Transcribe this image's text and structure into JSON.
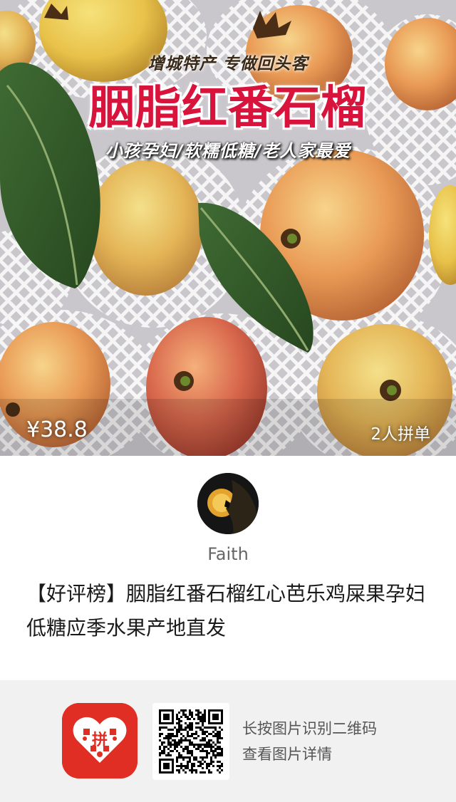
{
  "banner": {
    "slogan_top": "增城特产 专做回头客",
    "title": "胭脂红番石榴",
    "slogan_bottom": "小孩孕妇/软糯低糖/老人家最爱"
  },
  "price": "¥38.8",
  "group_buy": "2人拼单",
  "sharer": {
    "name": "Faith"
  },
  "product_title": "【好评榜】胭脂红番石榴红心芭乐鸡屎果孕妇低糖应季水果产地直发",
  "footer": {
    "app_logo_text": "拼",
    "hint_line1": "长按图片识别二维码",
    "hint_line2": "查看图片详情"
  },
  "colors": {
    "title_red": "#d8143c",
    "brand_red": "#e02e24",
    "footer_bg": "#f1f1f1"
  }
}
